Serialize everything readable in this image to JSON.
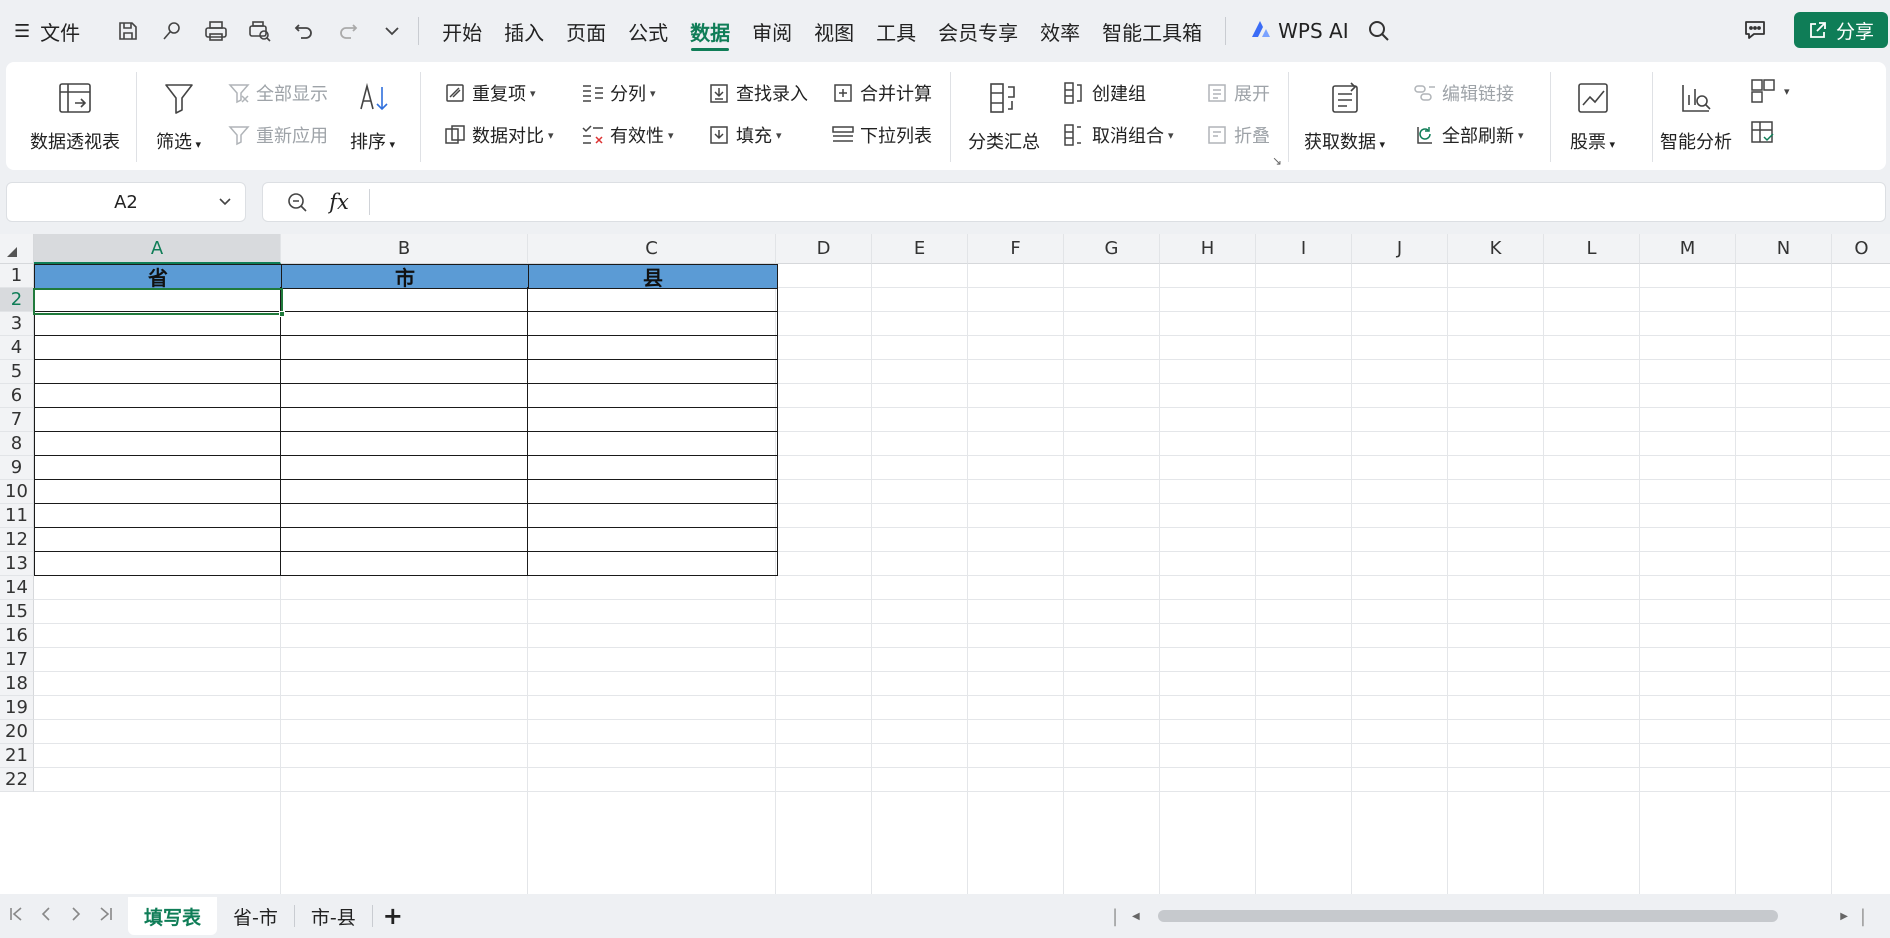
{
  "menubar": {
    "menu_icon": "☰",
    "file_label": "文件",
    "tabs": [
      "开始",
      "插入",
      "页面",
      "公式",
      "数据",
      "审阅",
      "视图",
      "工具",
      "会员专享",
      "效率",
      "智能工具箱"
    ],
    "active_tab": "数据",
    "wps_ai_label": "WPS AI",
    "share_label": "分享"
  },
  "ribbon": {
    "pivot_table": "数据透视表",
    "filter": "筛选",
    "show_all": "全部显示",
    "reapply": "重新应用",
    "sort": "排序",
    "duplicates": "重复项",
    "data_compare": "数据对比",
    "split_column": "分列",
    "validity": "有效性",
    "find_entry": "查找录入",
    "fill": "填充",
    "merge_calc": "合并计算",
    "dropdown_list": "下拉列表",
    "subtotal": "分类汇总",
    "create_group": "创建组",
    "ungroup": "取消组合",
    "expand": "展开",
    "collapse": "折叠",
    "get_data": "获取数据",
    "edit_links": "编辑链接",
    "refresh_all": "全部刷新",
    "stocks": "股票",
    "smart_analysis": "智能分析"
  },
  "formula_bar": {
    "name_box": "A2",
    "fx_label": "fx",
    "formula": ""
  },
  "grid": {
    "columns": [
      "A",
      "B",
      "C",
      "D",
      "E",
      "F",
      "G",
      "H",
      "I",
      "J",
      "K",
      "L",
      "M",
      "N",
      "O"
    ],
    "rows": [
      "1",
      "2",
      "3",
      "4",
      "5",
      "6",
      "7",
      "8",
      "9",
      "10",
      "11",
      "12",
      "13",
      "14",
      "15",
      "16",
      "17",
      "18",
      "19",
      "20",
      "21",
      "22"
    ],
    "selected_column": "A",
    "selected_row": "2",
    "table_headers": [
      "省",
      "市",
      "县"
    ]
  },
  "sheets": {
    "tabs": [
      "填写表",
      "省-市",
      "市-县"
    ],
    "active": "填写表",
    "add_label": "+"
  }
}
